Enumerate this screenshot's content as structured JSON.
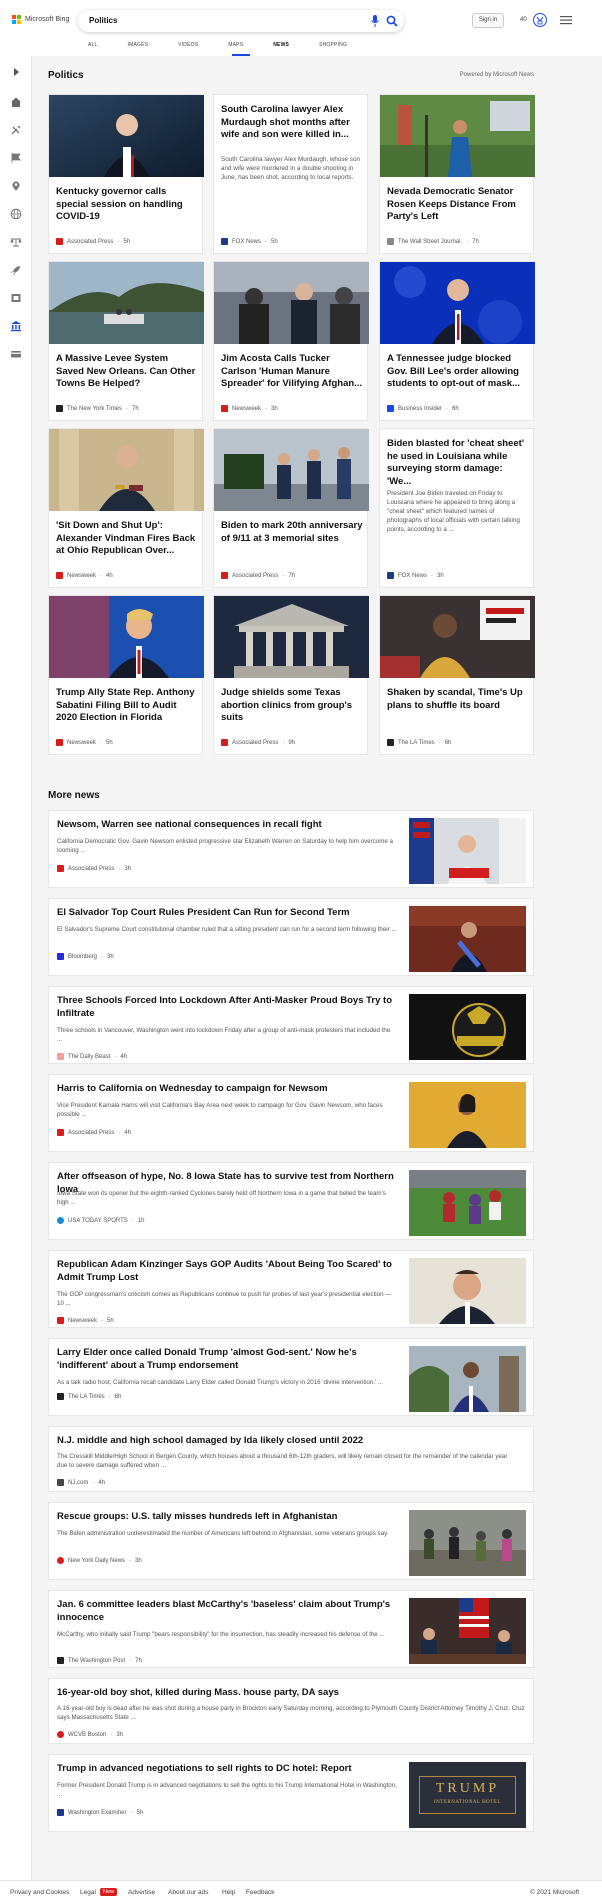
{
  "header": {
    "logo_text": "Microsoft Bing",
    "search_value": "Politics",
    "signin_label": "Sign in",
    "points": "40",
    "tabs": [
      "ALL",
      "IMAGES",
      "VIDEOS",
      "MAPS",
      "NEWS",
      "SHOPPING"
    ],
    "active_tab": "NEWS"
  },
  "section": {
    "title": "Politics",
    "powered_by": "Powered by Microsoft News"
  },
  "cards": [
    {
      "title": "Kentucky governor calls special session on handling COVID-19",
      "source": "Associated Press",
      "age": "5h",
      "src_color": "#d81b1b"
    },
    {
      "title": "South Carolina lawyer Alex Murdaugh shot months after wife and son were killed in...",
      "snippet": "South Carolina lawyer Alex Murdaugh, whose son and wife were murdered in a double shooting in June, has been shot, according to local reports.",
      "source": "FOX News",
      "age": "5h",
      "src_color": "#1a3a8a"
    },
    {
      "title": "Nevada Democratic Senator Rosen Keeps Distance From Party's Left",
      "source": "The Wall Street Journal.",
      "age": "7h",
      "src_color": "#666"
    },
    {
      "title": "A Massive Levee System Saved New Orleans. Can Other Towns Be Helped?",
      "source": "The New York Times",
      "age": "7h",
      "src_color": "#222"
    },
    {
      "title": "Jim Acosta Calls Tucker Carlson 'Human Manure Spreader' for Vilifying Afghan...",
      "source": "Newsweek",
      "age": "3h",
      "src_color": "#d81b1b"
    },
    {
      "title": "A Tennessee judge blocked Gov. Bill Lee's order allowing students to opt-out of mask...",
      "source": "Business Insider",
      "age": "6h",
      "src_color": "#174ae4"
    },
    {
      "title": "'Sit Down and Shut Up': Alexander Vindman Fires Back at Ohio Republican Over...",
      "source": "Newsweek",
      "age": "4h",
      "src_color": "#d81b1b"
    },
    {
      "title": "Biden to mark 20th anniversary of 9/11 at 3 memorial sites",
      "source": "Associated Press",
      "age": "7h",
      "src_color": "#d81b1b"
    },
    {
      "title": "Biden blasted for 'cheat sheet' he used in Louisiana while surveying storm damage: 'We...",
      "snippet": "President Joe Biden traveled on Friday to Louisiana where he appeared to bring along a \"cheat sheet\" which featured names of photographs of local officials with certain talking points, according to a ...",
      "source": "FOX News",
      "age": "3h",
      "src_color": "#1a3a8a"
    },
    {
      "title": "Trump Ally State Rep. Anthony Sabatini Filing Bill to Audit 2020 Election in Florida",
      "source": "Newsweek",
      "age": "5h",
      "src_color": "#d81b1b"
    },
    {
      "title": "Judge shields some Texas abortion clinics from group's suits",
      "source": "Associated Press",
      "age": "9h",
      "src_color": "#d81b1b"
    },
    {
      "title": "Shaken by scandal, Time's Up plans to shuffle its board",
      "source": "The LA Times",
      "age": "6h",
      "src_color": "#222"
    }
  ],
  "more_news": {
    "title": "More news",
    "items": [
      {
        "title": "Newsom, Warren see national consequences in recall fight",
        "snippet": "California Democratic Gov. Gavin Newsom enlisted progressive star Elizabeth Warren on Saturday to help him overcome a looming ...",
        "source": "Associated Press",
        "age": "3h",
        "src_color": "#d81b1b"
      },
      {
        "title": "El Salvador Top Court Rules President Can Run for Second Term",
        "snippet": "El Salvador's Supreme Court constitutional chamber ruled that a sitting president can run for a second term following their ...",
        "source": "Bloomberg",
        "age": "3h",
        "src_color": "#2b2bd8"
      },
      {
        "title": "Three Schools Forced Into Lockdown After Anti-Masker Proud Boys Try to Infiltrate",
        "snippet": "Three schools in Vancouver, Washington went into lockdown Friday after a group of anti-mask protesters that included the ...",
        "source": "The Daily Beast",
        "age": "4h",
        "src_color": "#f0a0a0"
      },
      {
        "title": "Harris to California on Wednesday to campaign for Newsom",
        "snippet": "Vice President Kamala Harris will visit California's Bay Area next week to campaign for Gov. Gavin Newsom, who faces possible ...",
        "source": "Associated Press",
        "age": "4h",
        "src_color": "#d81b1b"
      },
      {
        "title": "After offseason of hype, No. 8 Iowa State has to survive test from Northern Iowa",
        "snippet": "Iowa State won its opener but the eighth-ranked Cyclones barely held off Northern Iowa in a game that belied the team's high ...",
        "source": "USA TODAY SPORTS",
        "age": "1h",
        "src_color": "#1a8ad8"
      },
      {
        "title": "Republican Adam Kinzinger Says GOP Audits 'About Being Too Scared' to Admit Trump Lost",
        "snippet": "The GOP congressman's criticism comes as Republicans continue to push for probes of last year's presidential election —10 ...",
        "source": "Newsweek",
        "age": "5h",
        "src_color": "#d81b1b"
      },
      {
        "title": "Larry Elder once called Donald Trump 'almost God-sent.' Now he's 'indifferent' about a Trump endorsement",
        "snippet": "As a talk radio host, California recall candidate Larry Elder called Donald Trump's victory in 2016 'divine intervention.' ...",
        "source": "The LA Times",
        "age": "6h",
        "src_color": "#222"
      },
      {
        "title": "N.J. middle and high school damaged by Ida likely closed until 2022",
        "snippet": "The Cresskill Middle/High School in Bergen County, which houses about a thousand 6th-12th graders, will likely remain closed for the remainder of the calendar year due to severe damage suffered when ...",
        "source": "NJ.com",
        "age": "4h",
        "src_color": "#444"
      },
      {
        "title": "Rescue groups: U.S. tally misses hundreds left in Afghanistan",
        "snippet": "The Biden administration underestimated the number of Americans left behind in Afghanistan, some veterans groups say.",
        "source": "New York Daily News",
        "age": "3h",
        "src_color": "#d81b1b"
      },
      {
        "title": "Jan. 6 committee leaders blast McCarthy's 'baseless' claim about Trump's innocence",
        "snippet": "McCarthy, who initially said Trump \"bears responsibility\" for the insurrection, has steadily increased his defense of the ...",
        "source": "The Washington Post",
        "age": "7h",
        "src_color": "#222"
      },
      {
        "title": "16-year-old boy shot, killed during Mass. house party, DA says",
        "snippet": "A 16-year-old boy is dead after he was shot during a house party in Brockton early Saturday morning, according to Plymouth County District Attorney Timothy J. Cruz. Cruz says Massachusetts State ...",
        "source": "WCVB Boston",
        "age": "3h",
        "src_color": "#d81b1b"
      },
      {
        "title": "Trump in advanced negotiations to sell rights to DC hotel: Report",
        "snippet": "Former President Donald Trump is in advanced negotiations to sell the rights to his Trump International Hotel in Washington, ...",
        "source": "Washington Examiner",
        "age": "5h",
        "src_color": "#1a3a8a"
      }
    ],
    "hotel_sign": "TRUMP",
    "hotel_sub": "INTERNATIONAL HOTEL"
  },
  "footer": {
    "links": [
      "Privacy and Cookies",
      "Legal",
      "Advertise",
      "About our ads",
      "Help",
      "Feedback"
    ],
    "new_badge": "New",
    "copyright": "© 2021 Microsoft"
  },
  "colors": {
    "accent": "#174ae4",
    "background": "#f5f5f5"
  }
}
